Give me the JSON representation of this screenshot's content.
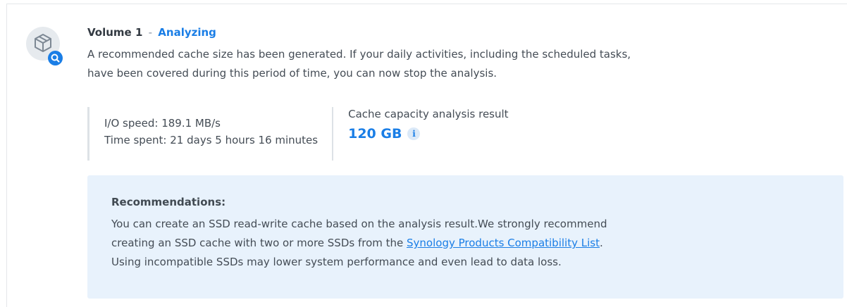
{
  "volume": {
    "name": "Volume 1",
    "separator": "-",
    "status": "Analyzing",
    "status_color": "#1a7ee6",
    "icon": "cube-icon",
    "badge_icon": "search-icon",
    "description_lines": [
      "A recommended cache size has been generated. If your daily activities, including the scheduled tasks,",
      "have been covered during this period of time, you can now stop the analysis."
    ]
  },
  "stats": {
    "io_speed": "I/O speed: 189.1 MB/s",
    "time_spent": "Time spent: 21 days 5 hours 16 minutes",
    "result_label": "Cache capacity analysis result",
    "result_value": "120 GB",
    "info_icon_glyph": "i"
  },
  "recommendations": {
    "title": "Recommendations:",
    "line1": "You can create an SSD read-write cache based on the analysis result.We strongly recommend",
    "line2_prefix": "creating an SSD cache with two or more SSDs from the ",
    "link_text": "Synology Products Compatibility List",
    "line2_suffix": ".",
    "line3": "Using incompatible SSDs may lower system performance and even lead to data loss.",
    "background_color": "#e8f2fc"
  }
}
